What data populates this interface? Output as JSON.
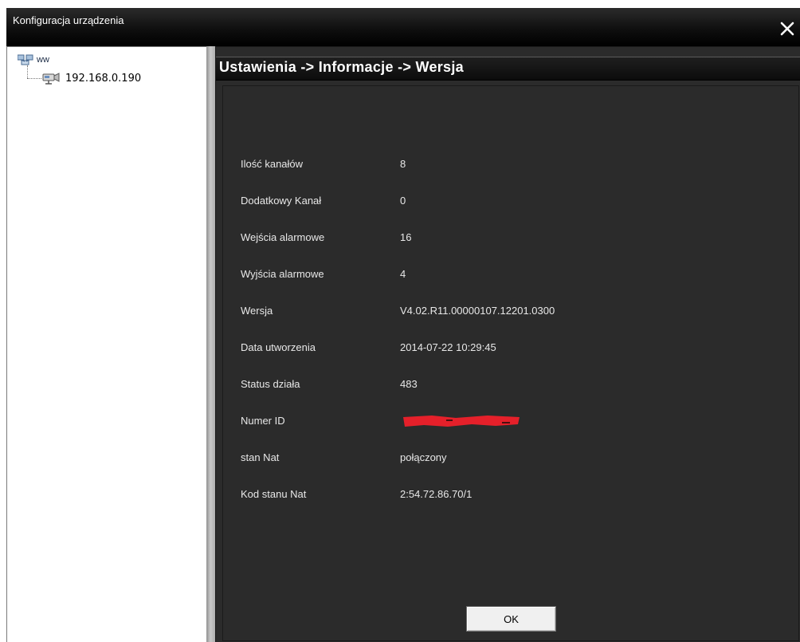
{
  "window": {
    "title": "Konfiguracja urządzenia",
    "close_icon": "close-icon"
  },
  "tree": {
    "root_label": "ww",
    "root_icon": "network-group-icon",
    "child_label": "192.168.0.190",
    "child_icon": "device-icon"
  },
  "breadcrumb": "Ustawienia -> Informacje -> Wersja",
  "info_rows": [
    {
      "label": "Ilość kanałów",
      "value": "8"
    },
    {
      "label": "Dodatkowy Kanał",
      "value": "0"
    },
    {
      "label": "Wejścia alarmowe",
      "value": "16"
    },
    {
      "label": "Wyjścia alarmowe",
      "value": "4"
    },
    {
      "label": "Wersja",
      "value": "V4.02.R11.00000107.12201.0300"
    },
    {
      "label": "Data utworzenia",
      "value": "2014-07-22 10:29:45"
    },
    {
      "label": "Status działa",
      "value": "483"
    },
    {
      "label": "Numer ID",
      "value": "",
      "redacted": true
    },
    {
      "label": "stan Nat",
      "value": "połączony"
    },
    {
      "label": "Kod stanu Nat",
      "value": "2:54.72.86.70/1"
    }
  ],
  "ok_label": "OK",
  "colors": {
    "content_bg": "#2b2b2b",
    "titlebar_bg": "#000000",
    "redaction": "#e5202a"
  }
}
